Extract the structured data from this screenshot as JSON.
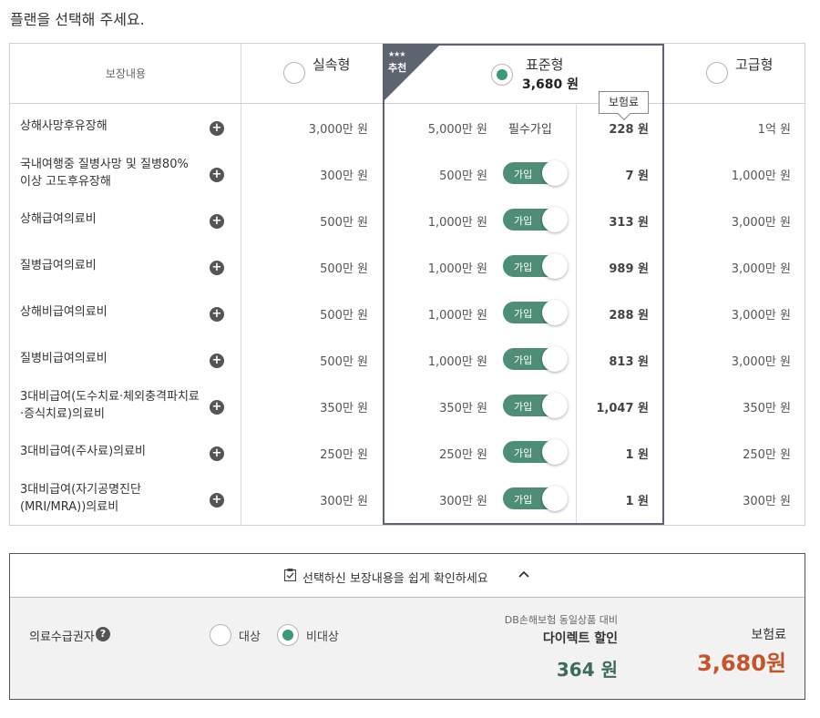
{
  "page_title": "플랜을 선택해 주세요.",
  "table": {
    "coverage_header": "보장내용",
    "plans": [
      {
        "name": "실속형",
        "selected": false
      },
      {
        "name": "표준형",
        "price": "3,680 원",
        "selected": true,
        "badge_stars": "★★★",
        "badge_text": "추천"
      },
      {
        "name": "고급형",
        "selected": false
      }
    ],
    "premium_tooltip": "보험료",
    "required_label": "필수가입",
    "join_label": "가입",
    "rows": [
      {
        "label": "상해사망후유장해",
        "basic": "3,000만 원",
        "standard": "5,000만 원",
        "premium": "228 원",
        "advanced": "1억 원",
        "mandatory": true
      },
      {
        "label": "국내여행중 질병사망 및 질병80% 이상 고도후유장해",
        "basic": "300만 원",
        "standard": "500만 원",
        "premium": "7 원",
        "advanced": "1,000만 원"
      },
      {
        "label": "상해급여의료비",
        "basic": "500만 원",
        "standard": "1,000만 원",
        "premium": "313 원",
        "advanced": "3,000만 원"
      },
      {
        "label": "질병급여의료비",
        "basic": "500만 원",
        "standard": "1,000만 원",
        "premium": "989 원",
        "advanced": "3,000만 원"
      },
      {
        "label": "상해비급여의료비",
        "basic": "500만 원",
        "standard": "1,000만 원",
        "premium": "288 원",
        "advanced": "3,000만 원"
      },
      {
        "label": "질병비급여의료비",
        "basic": "500만 원",
        "standard": "1,000만 원",
        "premium": "813 원",
        "advanced": "3,000만 원"
      },
      {
        "label": "3대비급여(도수치료·체외충격파치료·증식치료)의료비",
        "basic": "350만 원",
        "standard": "350만 원",
        "premium": "1,047 원",
        "advanced": "350만 원"
      },
      {
        "label": "3대비급여(주사료)의료비",
        "basic": "250만 원",
        "standard": "250만 원",
        "premium": "1 원",
        "advanced": "250만 원"
      },
      {
        "label": "3대비급여(자기공명진단 (MRI/MRA))의료비",
        "basic": "300만 원",
        "standard": "300만 원",
        "premium": "1 원",
        "advanced": "300만 원"
      }
    ]
  },
  "summary": {
    "toggle_text": "선택하신 보장내용을 쉽게 확인하세요",
    "medical_aid_label": "의료수급권자",
    "options": [
      {
        "label": "대상",
        "selected": false
      },
      {
        "label": "비대상",
        "selected": true
      }
    ],
    "discount_caption": "DB손해보험 동일상품 대비",
    "discount_title": "다이렉트 할인",
    "discount_amount": "364 원",
    "total_label": "보험료",
    "total_amount": "3,680원"
  },
  "colors": {
    "accent_green": "#4f8e76",
    "radio_green": "#3a9a7b",
    "ribbon": "#5d6470",
    "total_red": "#c6542b",
    "discount_green": "#3f6b5f"
  }
}
